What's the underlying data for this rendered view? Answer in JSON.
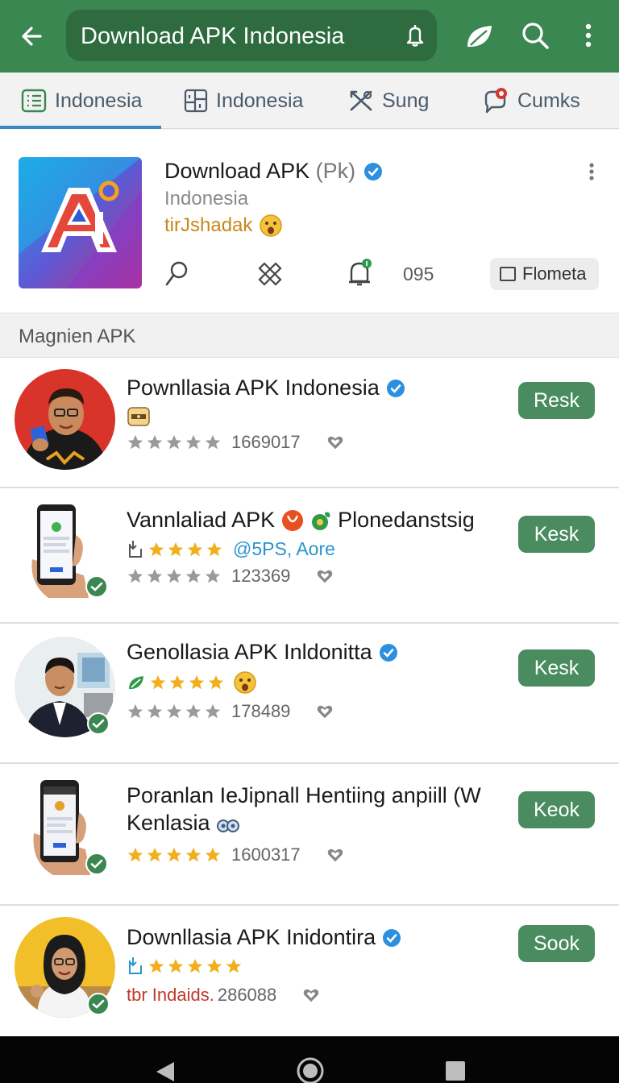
{
  "appbar": {
    "search_text": "Download APK Indonesia",
    "back_icon": "back-arrow-icon",
    "mic_icon": "microphone-icon",
    "leaf_icon": "leaf-icon",
    "search_icon": "search-icon",
    "more_icon": "more-vertical-icon",
    "color": "#3b8751"
  },
  "tabs": [
    {
      "label": "Indonesia",
      "icon": "list-icon",
      "active": true
    },
    {
      "label": "Indonesia",
      "icon": "grid-icon",
      "active": false
    },
    {
      "label": "Sung",
      "icon": "tools-icon",
      "active": false
    },
    {
      "label": "Cumks",
      "icon": "chat-bubble-icon",
      "active": false,
      "badge": "0"
    }
  ],
  "app": {
    "title": "Download APK",
    "title_suffix": "(Pk)",
    "subtitle": "Indonesia",
    "tag": "tirJshadak",
    "count": "095",
    "action_label": "Flometa"
  },
  "section": {
    "title": "Magnien APK"
  },
  "list": [
    {
      "title": "Pownllasia APK Indonesia",
      "verified": true,
      "rating_count": "1669017",
      "button": "Resk"
    },
    {
      "title": "Vannlaliad APK",
      "title_tail": "Plonedanstsig",
      "line2": "@5PS, Aore",
      "rating_count": "123369",
      "button": "Kesk"
    },
    {
      "title": "Genollasia APK Inldonitta",
      "verified": true,
      "rating_count": "178489",
      "button": "Kesk"
    },
    {
      "title": "Poranlan IeJipnall Hentiing anpiill (W Kenlasia",
      "rating_count": "1600317",
      "button": "Keok"
    },
    {
      "title": "Downllasia APK Inidontira",
      "verified": true,
      "line3_prefix": "tbr Indaids.",
      "rating_count": "286088",
      "button": "Sook"
    }
  ]
}
